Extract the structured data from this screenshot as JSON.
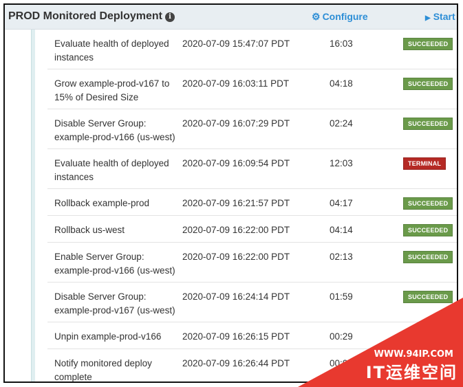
{
  "header": {
    "title": "PROD Monitored Deployment",
    "info_icon": "info-icon",
    "configure_label": "Configure",
    "configure_icon": "gear-icon",
    "start_label": "Start",
    "start_icon": "play-icon"
  },
  "colors": {
    "succeeded": "#6a9a4a",
    "terminal": "#b52a25",
    "link": "#2d8ed6"
  },
  "rows": [
    {
      "name": "Evaluate health of deployed instances",
      "timestamp": "2020-07-09 15:47:07 PDT",
      "duration": "16:03",
      "status": "SUCCEEDED"
    },
    {
      "name": "Grow example-prod-v167 to 15% of Desired Size",
      "timestamp": "2020-07-09 16:03:11 PDT",
      "duration": "04:18",
      "status": "SUCCEEDED"
    },
    {
      "name": "Disable Server Group: example-prod-v166 (us-west)",
      "timestamp": "2020-07-09 16:07:29 PDT",
      "duration": "02:24",
      "status": "SUCCEEDED"
    },
    {
      "name": "Evaluate health of deployed instances",
      "timestamp": "2020-07-09 16:09:54 PDT",
      "duration": "12:03",
      "status": "TERMINAL"
    },
    {
      "name": "Rollback example-prod",
      "timestamp": "2020-07-09 16:21:57 PDT",
      "duration": "04:17",
      "status": "SUCCEEDED"
    },
    {
      "name": "Rollback us-west",
      "timestamp": "2020-07-09 16:22:00 PDT",
      "duration": "04:14",
      "status": "SUCCEEDED"
    },
    {
      "name": "Enable Server Group: example-prod-v166 (us-west)",
      "timestamp": "2020-07-09 16:22:00 PDT",
      "duration": "02:13",
      "status": "SUCCEEDED"
    },
    {
      "name": "Disable Server Group: example-prod-v167 (us-west)",
      "timestamp": "2020-07-09 16:24:14 PDT",
      "duration": "01:59",
      "status": "SUCCEEDED"
    },
    {
      "name": "Unpin example-prod-v166",
      "timestamp": "2020-07-09 16:26:15 PDT",
      "duration": "00:29",
      "status": ""
    },
    {
      "name": "Notify monitored deploy complete",
      "timestamp": "2020-07-09 16:26:44 PDT",
      "duration": "00:00",
      "status": ""
    }
  ],
  "watermark": {
    "url": "WWW.94IP.COM",
    "text": "IT运维空间",
    "color": "#e8392f"
  }
}
